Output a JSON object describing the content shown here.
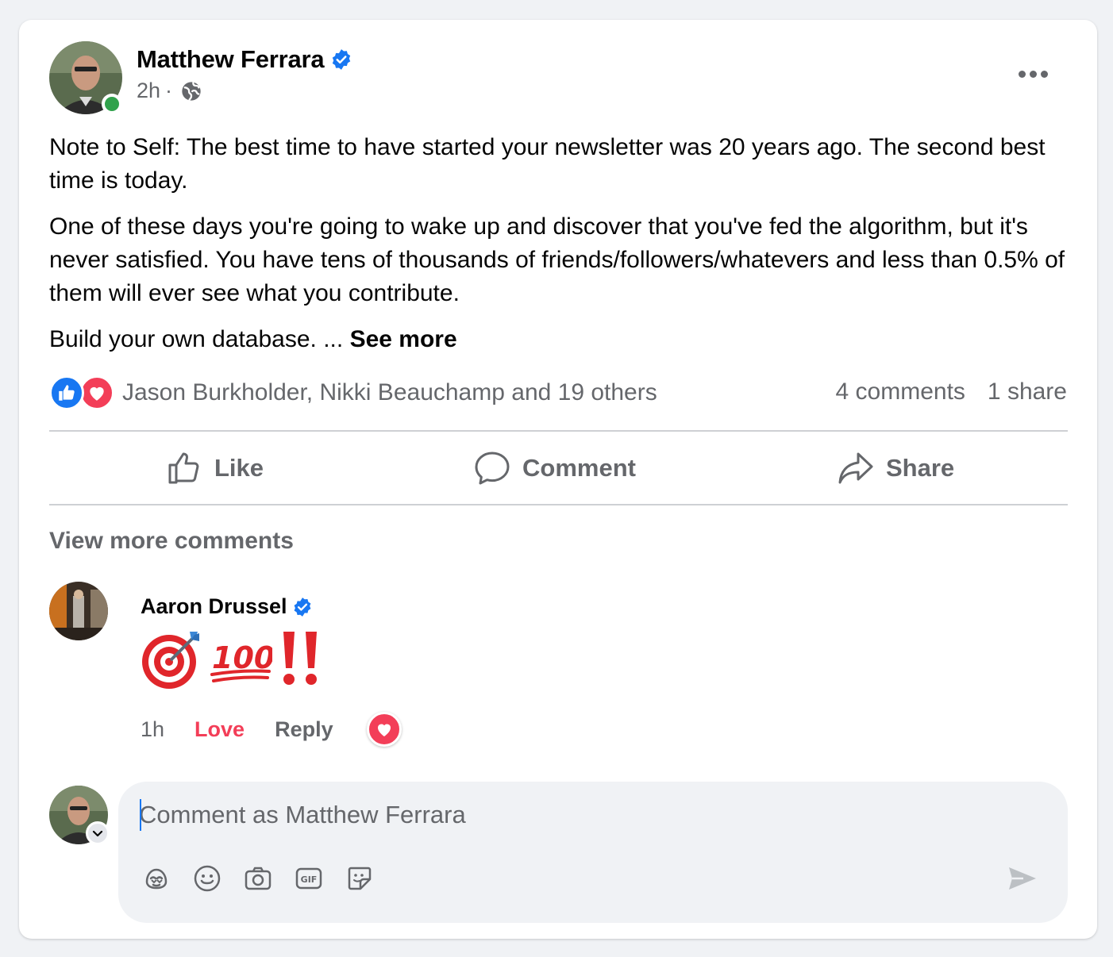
{
  "post": {
    "author": "Matthew Ferrara",
    "time": "2h",
    "separator": "·",
    "paragraphs": [
      "Note to Self: The best time to have started your newsletter was 20 years ago. The second best time is today.",
      "One of these days you're going to wake up and discover that you've fed the algorithm, but it's never satisfied. You have tens of thousands of friends/followers/whatevers and less than 0.5% of them will ever see what you contribute."
    ],
    "truncated_text": "Build your own database. ... ",
    "see_more": "See more"
  },
  "reactions": {
    "names": "Jason Burkholder, Nikki Beauchamp and 19 others",
    "comments_count": "4 comments",
    "shares_count": "1 share"
  },
  "actions": {
    "like": "Like",
    "comment": "Comment",
    "share": "Share"
  },
  "comments": {
    "view_more": "View more comments",
    "items": [
      {
        "author": "Aaron Drussel",
        "content_emojis": [
          "target-emoji",
          "hundred-points-emoji",
          "double-exclamation-emoji"
        ],
        "time": "1h",
        "reaction_label": "Love",
        "reply_label": "Reply"
      }
    ]
  },
  "composer": {
    "placeholder": "Comment as Matthew Ferrara",
    "tools": [
      "avatar-sticker-icon",
      "emoji-icon",
      "camera-icon",
      "gif-icon",
      "sticker-icon"
    ]
  },
  "colors": {
    "facebook_blue": "#1877f2",
    "love_red": "#f33e58",
    "secondary_text": "#65676b",
    "online_green": "#31a24c"
  }
}
